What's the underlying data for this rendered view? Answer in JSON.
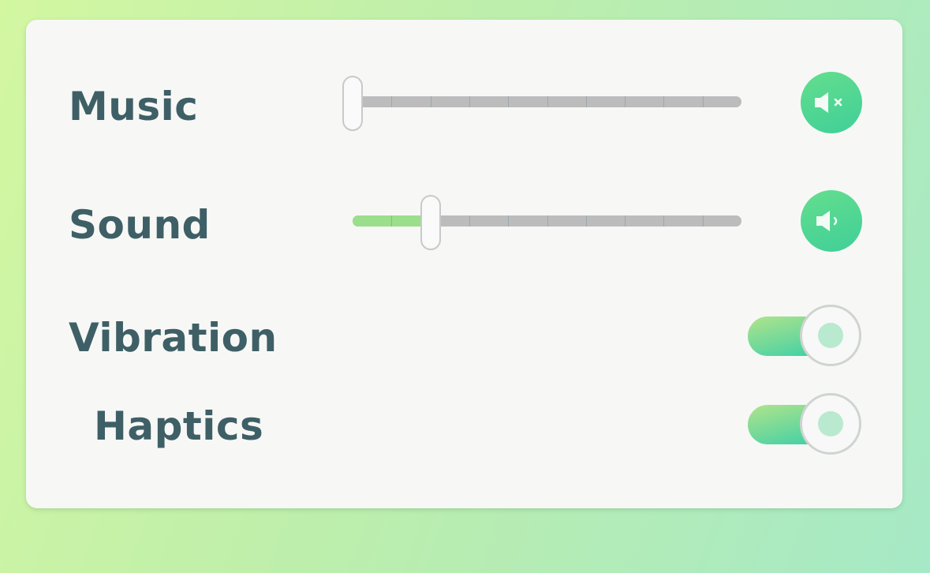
{
  "settings": {
    "music": {
      "label": "Music",
      "volume_percent": 0,
      "muted": true,
      "icon": "speaker-muted-icon"
    },
    "sound": {
      "label": "Sound",
      "volume_percent": 20,
      "muted": false,
      "icon": "speaker-low-icon"
    },
    "vibration": {
      "label": "Vibration",
      "enabled": true
    },
    "haptics": {
      "label": "Haptics",
      "enabled": true
    }
  },
  "colors": {
    "label_text": "#3f5f66",
    "accent_green": "#40cf99",
    "slider_fill": "#9bde8b",
    "slider_track": "#bcbcbc",
    "panel_background": "#f7f8f6"
  }
}
